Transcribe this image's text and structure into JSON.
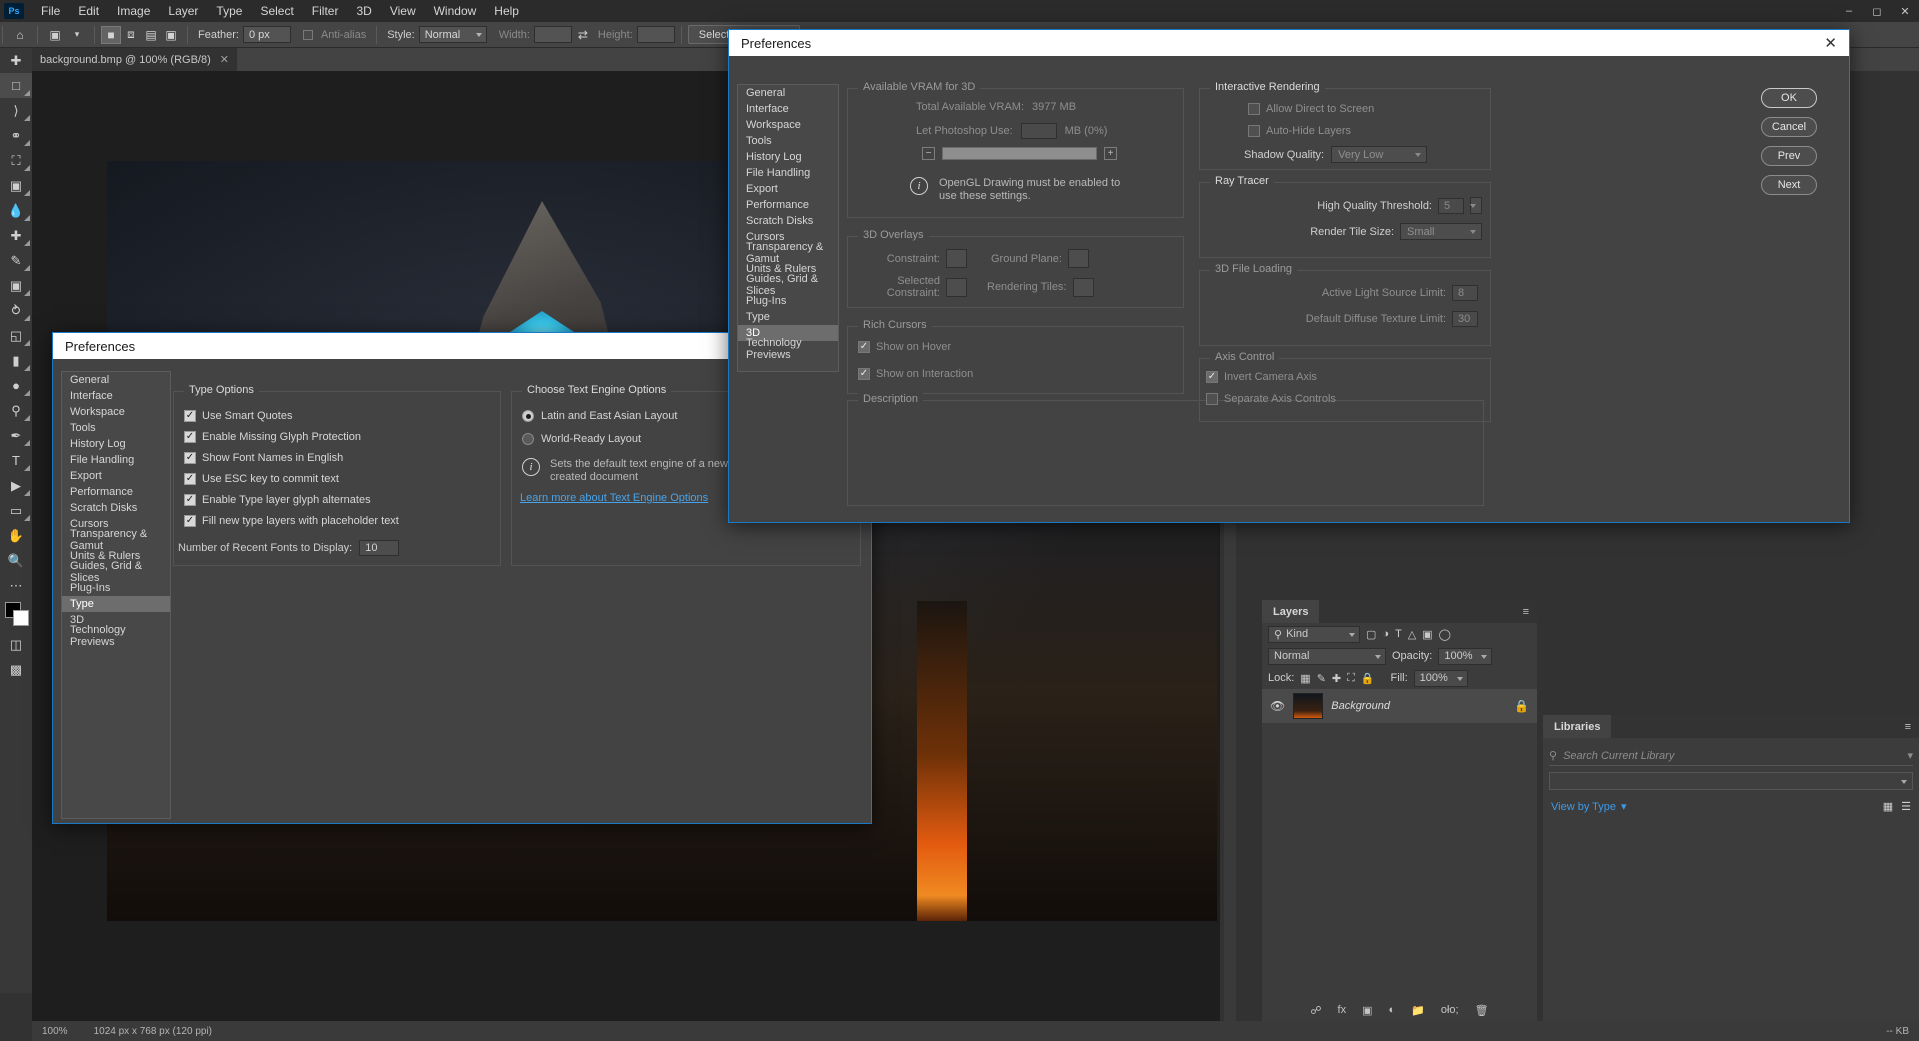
{
  "app": {
    "logo": "Ps",
    "menus": [
      "File",
      "Edit",
      "Image",
      "Layer",
      "Type",
      "Select",
      "Filter",
      "3D",
      "View",
      "Window",
      "Help"
    ],
    "window_buttons": [
      "minimize",
      "maximize",
      "close"
    ]
  },
  "options_bar": {
    "home_icon": "home-icon",
    "marquee_icon": "rectangular-marquee-icon",
    "selection_modes": [
      "new-selection",
      "add-to-selection",
      "subtract-from-selection",
      "intersect-selection"
    ],
    "feather_label": "Feather:",
    "feather_value": "0 px",
    "antialias_label": "Anti-alias",
    "style_label": "Style:",
    "style_value": "Normal",
    "width_label": "Width:",
    "width_value": "",
    "swap_icon": "swap-dimensions-icon",
    "height_label": "Height:",
    "height_value": "",
    "select_and_mask": "Select and Mask..."
  },
  "document": {
    "tab_title": "background.bmp @ 100% (RGB/8)",
    "close_icon": "close-icon"
  },
  "toolbox": {
    "tools": [
      "move-tool",
      "rectangular-marquee-tool",
      "lasso-tool",
      "quick-selection-tool",
      "crop-tool",
      "frame-tool",
      "eyedropper-tool",
      "spot-healing-brush-tool",
      "brush-tool",
      "clone-stamp-tool",
      "history-brush-tool",
      "eraser-tool",
      "gradient-tool",
      "blur-tool",
      "dodge-tool",
      "pen-tool",
      "horizontal-type-tool",
      "path-selection-tool",
      "rectangle-tool",
      "hand-tool",
      "zoom-tool",
      "edit-toolbar-tool"
    ],
    "foreground_color": "#000000",
    "background_color": "#ffffff"
  },
  "layers_panel": {
    "tab_label": "Layers",
    "menu_icon": "panel-menu-icon",
    "filter_label": "Kind",
    "blend_mode": "Normal",
    "opacity_label": "Opacity:",
    "opacity_value": "100%",
    "lock_label": "Lock:",
    "lock_icons": [
      "lock-transparent-pixels-icon",
      "lock-image-pixels-icon",
      "lock-position-icon",
      "lock-artboard-icon",
      "lock-all-icon"
    ],
    "fill_label": "Fill:",
    "fill_value": "100%",
    "layers": [
      {
        "name": "Background",
        "visible": true,
        "locked": true,
        "eye_icon": "eye-icon",
        "lock_icon": "lock-icon"
      }
    ],
    "footer_icons": [
      "link-layers-icon",
      "layer-style-icon",
      "layer-mask-icon",
      "adjustment-layer-icon",
      "new-group-icon",
      "new-layer-icon",
      "delete-layer-icon"
    ]
  },
  "libraries_panel": {
    "tab_label": "Libraries",
    "menu_icon": "panel-menu-icon",
    "search_icon": "search-icon",
    "search_placeholder": "Search Current Library",
    "library_select_value": "",
    "view_by_label": "View by Type",
    "grid_icon": "grid-view-icon",
    "list_icon": "list-view-icon"
  },
  "status_bar": {
    "zoom": "100%",
    "doc_info": "1024 px x 768 px (120 ppi)",
    "size_info": "-- KB"
  },
  "nav_items": [
    "General",
    "Interface",
    "Workspace",
    "Tools",
    "History Log",
    "File Handling",
    "Export",
    "Performance",
    "Scratch Disks",
    "Cursors",
    "Transparency & Gamut",
    "Units & Rulers",
    "Guides, Grid & Slices",
    "Plug-Ins",
    "Type",
    "3D",
    "Technology Previews"
  ],
  "dialog_3d": {
    "title": "Preferences",
    "close_icon": "close-icon",
    "selected_nav": "3D",
    "vram": {
      "group_label": "Available VRAM for 3D",
      "total_label": "Total Available VRAM:",
      "total_value": "3977 MB",
      "let_use_label": "Let Photoshop Use:",
      "let_use_value": "",
      "unit_label": "MB (0%)",
      "minus_icon": "minus-stepper-icon",
      "plus_icon": "plus-stepper-icon",
      "info_icon": "info-icon",
      "info_text": "OpenGL Drawing must be enabled to use these settings."
    },
    "overlays": {
      "group_label": "3D Overlays",
      "constraint_label": "Constraint:",
      "ground_plane_label": "Ground Plane:",
      "selected_constraint_label": "Selected Constraint:",
      "rendering_tiles_label": "Rendering Tiles:"
    },
    "rich_cursors": {
      "group_label": "Rich Cursors",
      "items": [
        {
          "label": "Show on Hover",
          "checked": true
        },
        {
          "label": "Show on Interaction",
          "checked": true
        }
      ]
    },
    "description": {
      "group_label": "Description",
      "text": ""
    },
    "interactive": {
      "group_label": "Interactive Rendering",
      "items": [
        {
          "label": "Allow Direct to Screen",
          "checked": false
        },
        {
          "label": "Auto-Hide Layers",
          "checked": false
        }
      ],
      "shadow_quality_label": "Shadow Quality:",
      "shadow_quality_value": "Very Low"
    },
    "ray_tracer": {
      "group_label": "Ray Tracer",
      "threshold_label": "High Quality Threshold:",
      "threshold_value": "5",
      "tile_size_label": "Render Tile Size:",
      "tile_size_value": "Small"
    },
    "file_loading": {
      "group_label": "3D File Loading",
      "light_limit_label": "Active Light Source Limit:",
      "light_limit_value": "8",
      "texture_limit_label": "Default Diffuse Texture Limit:",
      "texture_limit_value": "30"
    },
    "axis_control": {
      "group_label": "Axis Control",
      "items": [
        {
          "label": "Invert Camera Axis",
          "checked": true
        },
        {
          "label": "Separate Axis Controls",
          "checked": false
        }
      ]
    },
    "buttons": [
      "OK",
      "Cancel",
      "Prev",
      "Next"
    ]
  },
  "dialog_type": {
    "title": "Preferences",
    "selected_nav": "Type",
    "type_options": {
      "group_label": "Type Options",
      "items": [
        {
          "label": "Use Smart Quotes",
          "checked": true
        },
        {
          "label": "Enable Missing Glyph Protection",
          "checked": true
        },
        {
          "label": "Show Font Names in English",
          "checked": true
        },
        {
          "label": "Use ESC key to commit text",
          "checked": true
        },
        {
          "label": "Enable Type layer glyph alternates",
          "checked": true
        },
        {
          "label": "Fill new type layers with placeholder text",
          "checked": true
        }
      ],
      "recent_fonts_label": "Number of Recent Fonts to Display:",
      "recent_fonts_value": "10"
    },
    "text_engine": {
      "group_label": "Choose Text Engine Options",
      "options": [
        {
          "label": "Latin and East Asian Layout",
          "selected": true
        },
        {
          "label": "World-Ready Layout",
          "selected": false
        }
      ],
      "info_icon": "info-icon",
      "info_text": "Sets the default text engine of a newly created document",
      "link_text": "Learn more about Text Engine Options"
    }
  },
  "colors": {
    "accent": "#1a78c8",
    "link": "#4aa3e8",
    "panel_bg": "#434343",
    "app_bg": "#323232"
  }
}
